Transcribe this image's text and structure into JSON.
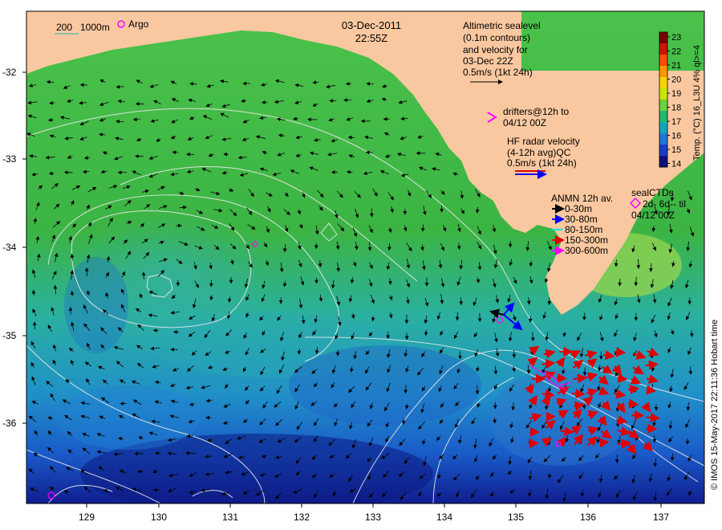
{
  "header": {
    "date": "03-Dec-2011",
    "time": "22:55Z"
  },
  "scale_legend": {
    "contour_200": "200",
    "contour_1000": "1000m",
    "argo_label": "Argo"
  },
  "altimetry_note": {
    "lines": [
      "Altimetric sealevel",
      "(0.1m contours)",
      "and velocity for",
      "03-Dec 22Z",
      "0.5m/s (1kt 24h)"
    ]
  },
  "drifters_note": {
    "lines": [
      "drifters@12h to",
      "04/12 00Z"
    ]
  },
  "hf_radar_note": {
    "lines": [
      "HF radar velocity",
      "(4-12h avg)QC",
      "0.5m/s (1kt 24h)"
    ]
  },
  "anmn_legend": {
    "title": "ANMN 12h av.",
    "items": [
      {
        "label": "0-30m",
        "color": "#000000"
      },
      {
        "label": "30-80m",
        "color": "#0000ff"
      },
      {
        "label": "80-150m",
        "color": "#00e5e5"
      },
      {
        "label": "150-300m",
        "color": "#ff0000"
      },
      {
        "label": "300-600m",
        "color": "#ff00ff"
      }
    ]
  },
  "seal_ctd_note": {
    "lines": [
      "sealCTDs",
      "2d- 6d-- til",
      "04/12 00Z"
    ]
  },
  "colorbar": {
    "title": "Temp. (°C) 16_L3U 4% ql>=4",
    "ticks": [
      "23",
      "22",
      "21",
      "20",
      "19",
      "18",
      "17",
      "16",
      "15",
      "14"
    ],
    "colors": [
      "#7a0000",
      "#c81800",
      "#ff4a00",
      "#ff9600",
      "#f5d400",
      "#c8e600",
      "#6ad23a",
      "#22b86e",
      "#10a8b8",
      "#1e78d8",
      "#1a3cc8",
      "#10127a"
    ]
  },
  "axes": {
    "x_ticks": [
      "129",
      "130",
      "131",
      "132",
      "133",
      "134",
      "135",
      "136",
      "137"
    ],
    "y_ticks": [
      "-32",
      "-33",
      "-34",
      "-35",
      "-36"
    ]
  },
  "credit": "© IMOS 15-May-2017 22:11:36 Hobart time",
  "colors": {
    "land": "#fac8a0",
    "water_green": "#3cb43c",
    "water_cyan": "#22b4b4",
    "water_blue": "#1a50c8"
  }
}
